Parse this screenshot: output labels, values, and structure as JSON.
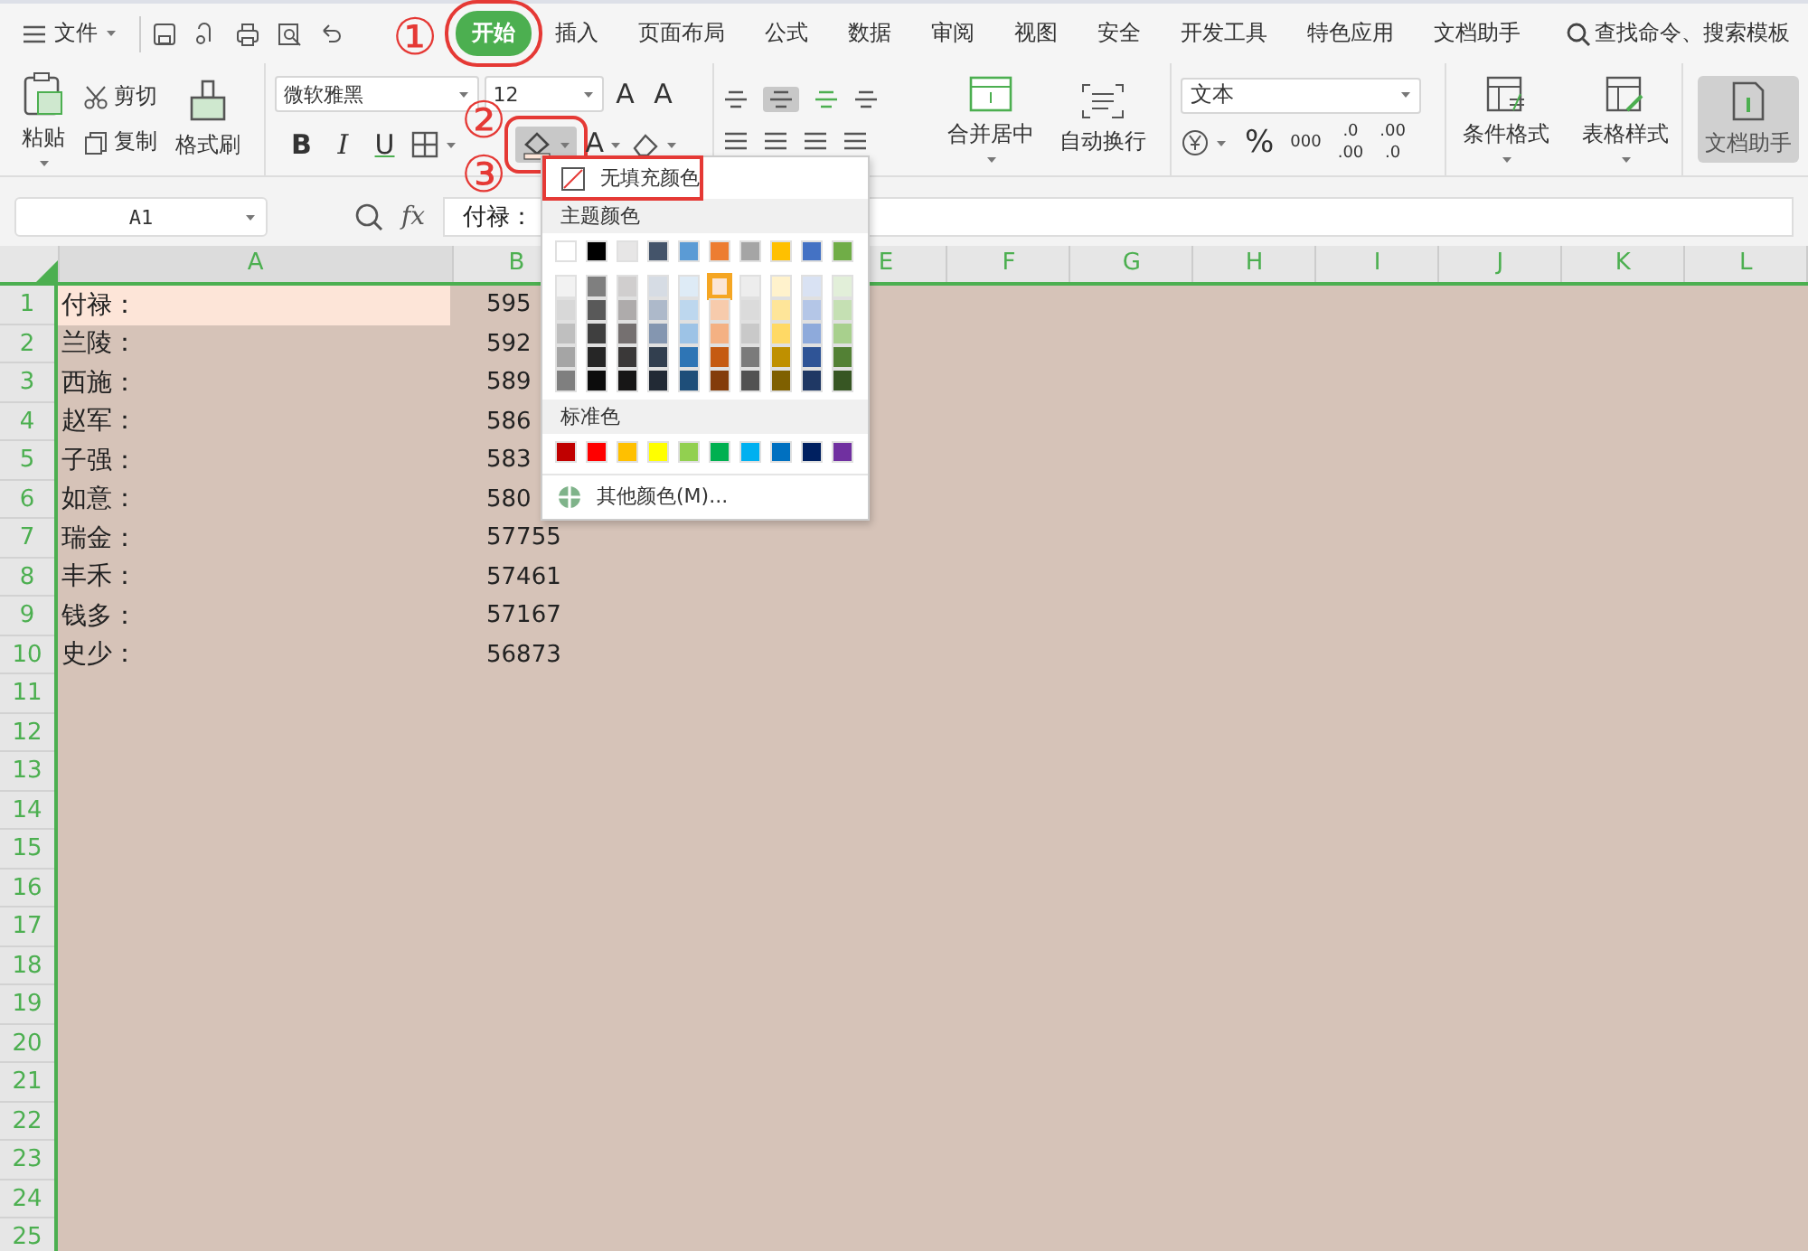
{
  "menu": {
    "label": "文件"
  },
  "tabs": [
    {
      "label": "开始",
      "selected": true,
      "highlighted": true
    },
    {
      "label": "插入",
      "selected": false,
      "highlighted": false
    },
    {
      "label": "页面布局",
      "selected": false,
      "highlighted": false
    },
    {
      "label": "公式",
      "selected": false,
      "highlighted": false
    },
    {
      "label": "数据",
      "selected": false,
      "highlighted": false
    },
    {
      "label": "审阅",
      "selected": false,
      "highlighted": false
    },
    {
      "label": "视图",
      "selected": false,
      "highlighted": false
    },
    {
      "label": "安全",
      "selected": false,
      "highlighted": false
    },
    {
      "label": "开发工具",
      "selected": false,
      "highlighted": false
    },
    {
      "label": "特色应用",
      "selected": false,
      "highlighted": false
    },
    {
      "label": "文档助手",
      "selected": false,
      "highlighted": false
    }
  ],
  "search": {
    "placeholder": "查找命令、搜索模板"
  },
  "ribbon": {
    "clipboard": {
      "paste": "粘贴",
      "cut": "剪切",
      "copy": "复制",
      "format_painter": "格式刷"
    },
    "font": {
      "family": "微软雅黑",
      "size": "12",
      "grow": "A",
      "shrink": "A",
      "styles": [
        "B",
        "I",
        "U"
      ],
      "font_color": "A",
      "fill_highlighted": true
    },
    "alignment": {
      "merge": "合并居中",
      "wrap": "自动换行"
    },
    "number": {
      "format": "文本",
      "percent": "%",
      "thousands": "000",
      "increase_decimal": [
        ".0",
        ".00"
      ],
      "decrease_decimal": [
        ".00",
        ".0"
      ]
    },
    "styles": {
      "conditional": "条件格式",
      "table": "表格样式"
    },
    "assistant": {
      "label": "文档助手",
      "selected": true
    }
  },
  "formula_bar": {
    "name_box": "A1",
    "fx": "fx",
    "formula": "付禄："
  },
  "sheet": {
    "columns": [
      "A",
      "B",
      "E",
      "F",
      "G",
      "H",
      "I",
      "J",
      "K",
      "L"
    ],
    "row_headers": [
      "1",
      "2",
      "3",
      "4",
      "5",
      "6",
      "7",
      "8",
      "9",
      "10",
      "11",
      "12",
      "13",
      "14",
      "15",
      "16",
      "17",
      "18",
      "19",
      "20",
      "21",
      "22",
      "23",
      "24",
      "25"
    ],
    "rows": [
      {
        "a": "付禄：",
        "b": "595",
        "selected": true
      },
      {
        "a": "兰陵：",
        "b": "592",
        "selected": false
      },
      {
        "a": "西施：",
        "b": "589",
        "selected": false
      },
      {
        "a": "赵军：",
        "b": "586",
        "selected": false
      },
      {
        "a": "子强：",
        "b": "583",
        "selected": false
      },
      {
        "a": "如意：",
        "b": "580",
        "selected": false
      },
      {
        "a": "瑞金：",
        "b": "57755",
        "selected": false
      },
      {
        "a": "丰禾：",
        "b": "57461",
        "selected": false
      },
      {
        "a": "钱多：",
        "b": "57167",
        "selected": false
      },
      {
        "a": "史少：",
        "b": "56873",
        "selected": false
      }
    ]
  },
  "dropdown": {
    "no_fill": "无填充颜色",
    "no_fill_highlighted": true,
    "theme_title": "主题颜色",
    "theme": [
      {
        "color": "#ffffff",
        "selected": false
      },
      {
        "color": "#000000",
        "selected": false
      },
      {
        "color": "#e7e6e6",
        "selected": false
      },
      {
        "color": "#44546a",
        "selected": false
      },
      {
        "color": "#5b9bd5",
        "selected": false
      },
      {
        "color": "#ed7d31",
        "selected": false
      },
      {
        "color": "#a5a5a5",
        "selected": false
      },
      {
        "color": "#ffc000",
        "selected": false
      },
      {
        "color": "#4472c4",
        "selected": false
      },
      {
        "color": "#70ad47",
        "selected": false
      }
    ],
    "shades": [
      [
        {
          "color": "#f2f2f2",
          "selected": false
        },
        {
          "color": "#7f7f7f",
          "selected": false
        },
        {
          "color": "#d0cece",
          "selected": false
        },
        {
          "color": "#d6dce4",
          "selected": false
        },
        {
          "color": "#deebf6",
          "selected": false
        },
        {
          "color": "#fbe5d5",
          "selected": true
        },
        {
          "color": "#ededed",
          "selected": false
        },
        {
          "color": "#fff2cc",
          "selected": false
        },
        {
          "color": "#d9e2f3",
          "selected": false
        },
        {
          "color": "#e2efd9",
          "selected": false
        }
      ],
      [
        {
          "color": "#d8d8d8",
          "selected": false
        },
        {
          "color": "#595959",
          "selected": false
        },
        {
          "color": "#aeabab",
          "selected": false
        },
        {
          "color": "#adb9ca",
          "selected": false
        },
        {
          "color": "#bdd7ee",
          "selected": false
        },
        {
          "color": "#f7cbac",
          "selected": false
        },
        {
          "color": "#dbdbdb",
          "selected": false
        },
        {
          "color": "#fee599",
          "selected": false
        },
        {
          "color": "#b4c6e7",
          "selected": false
        },
        {
          "color": "#c5e0b3",
          "selected": false
        }
      ],
      [
        {
          "color": "#bfbfbf",
          "selected": false
        },
        {
          "color": "#3f3f3f",
          "selected": false
        },
        {
          "color": "#757070",
          "selected": false
        },
        {
          "color": "#8496b0",
          "selected": false
        },
        {
          "color": "#9dc3e6",
          "selected": false
        },
        {
          "color": "#f4b183",
          "selected": false
        },
        {
          "color": "#c9c9c9",
          "selected": false
        },
        {
          "color": "#ffd965",
          "selected": false
        },
        {
          "color": "#8eaadb",
          "selected": false
        },
        {
          "color": "#a8d08d",
          "selected": false
        }
      ],
      [
        {
          "color": "#a5a5a5",
          "selected": false
        },
        {
          "color": "#262626",
          "selected": false
        },
        {
          "color": "#3a3838",
          "selected": false
        },
        {
          "color": "#323f4f",
          "selected": false
        },
        {
          "color": "#2e75b5",
          "selected": false
        },
        {
          "color": "#c55a11",
          "selected": false
        },
        {
          "color": "#7b7b7b",
          "selected": false
        },
        {
          "color": "#bf9000",
          "selected": false
        },
        {
          "color": "#2f5496",
          "selected": false
        },
        {
          "color": "#538135",
          "selected": false
        }
      ],
      [
        {
          "color": "#7f7f7f",
          "selected": false
        },
        {
          "color": "#0c0c0c",
          "selected": false
        },
        {
          "color": "#171616",
          "selected": false
        },
        {
          "color": "#222a35",
          "selected": false
        },
        {
          "color": "#1e4e79",
          "selected": false
        },
        {
          "color": "#833c0b",
          "selected": false
        },
        {
          "color": "#525252",
          "selected": false
        },
        {
          "color": "#7f6000",
          "selected": false
        },
        {
          "color": "#1f3864",
          "selected": false
        },
        {
          "color": "#375623",
          "selected": false
        }
      ]
    ],
    "standard_title": "标准色",
    "standard": [
      {
        "color": "#c00000",
        "selected": false
      },
      {
        "color": "#ff0000",
        "selected": false
      },
      {
        "color": "#ffc000",
        "selected": false
      },
      {
        "color": "#ffff00",
        "selected": false
      },
      {
        "color": "#92d050",
        "selected": false
      },
      {
        "color": "#00b050",
        "selected": false
      },
      {
        "color": "#00b0f0",
        "selected": false
      },
      {
        "color": "#0070c0",
        "selected": false
      },
      {
        "color": "#002060",
        "selected": false
      },
      {
        "color": "#7030a0",
        "selected": false
      }
    ],
    "more": "其他颜色(M)..."
  },
  "annotations": [
    {
      "text": "①"
    },
    {
      "text": "②"
    },
    {
      "text": "③"
    }
  ]
}
